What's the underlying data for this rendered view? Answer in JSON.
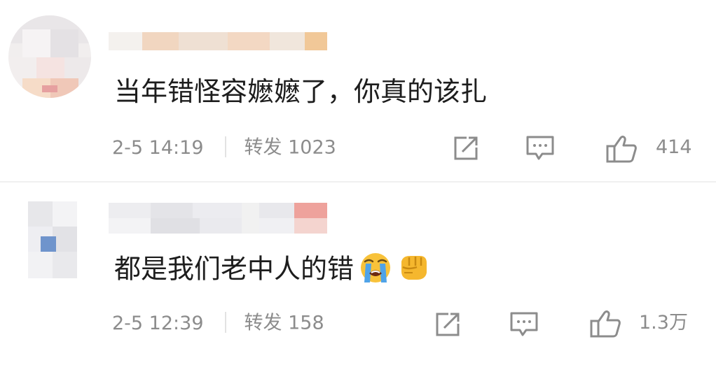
{
  "comments": [
    {
      "text": "当年错怪容嬷嬷了，你真的该扎",
      "emojis": [],
      "time": "2-5 14:19",
      "forward_label": "转发 1023",
      "likes": "414"
    },
    {
      "text": "都是我们老中人的错",
      "emojis": [
        "crying-face-emoji",
        "fist-emoji"
      ],
      "time": "2-5 12:39",
      "forward_label": "转发 158",
      "likes": "1.3万"
    }
  ],
  "colors": {
    "text": "#1d1d1d",
    "meta": "#8c8c8c",
    "icon": "#8c8c8c",
    "divider": "#f0f0f0"
  }
}
